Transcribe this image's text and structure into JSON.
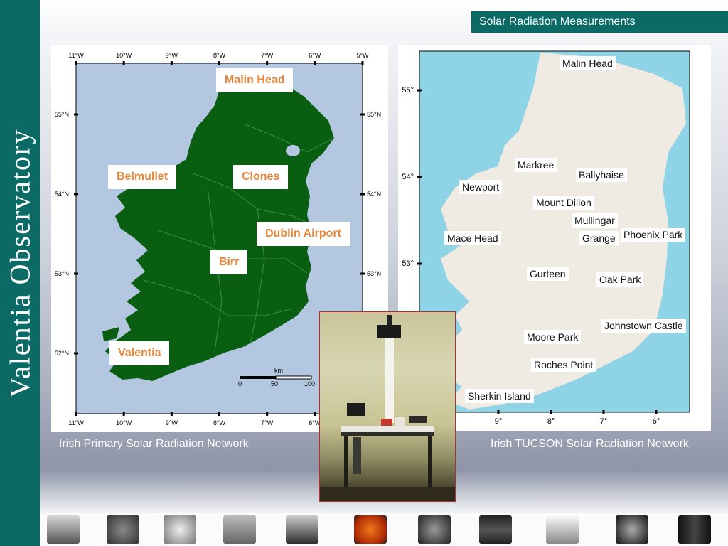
{
  "sidebar": {
    "title": "Valentia  Observatory"
  },
  "header": {
    "title": "Solar Radiation Measurements"
  },
  "left_map": {
    "caption": "Irish Primary Solar Radiation Network",
    "top_ticks": [
      "11°W",
      "10°W",
      "9°W",
      "8°W",
      "7°W",
      "6°W",
      "5°W"
    ],
    "bottom_ticks": [
      "11°W",
      "10°W",
      "9°W",
      "8°W",
      "7°W",
      "6°W"
    ],
    "left_ticks": [
      "55°N",
      "54°N",
      "53°N",
      "52°N"
    ],
    "right_ticks": [
      "55°N",
      "54°N",
      "53°N"
    ],
    "scale_unit": "km",
    "scale_values": [
      "0",
      "50",
      "100"
    ],
    "stations": [
      "Malin Head",
      "Belmullet",
      "Clones",
      "Dublin Airport",
      "Birr",
      "Valentia"
    ],
    "colors": {
      "sea": "#b3c7e0",
      "land": "#0a5e12"
    }
  },
  "right_map": {
    "caption": "Irish TUCSON Solar Radiation Network",
    "left_ticks": [
      "55°",
      "54°",
      "53°"
    ],
    "bottom_ticks": [
      "9°",
      "8°",
      "7°",
      "6°"
    ],
    "stations": [
      "Malin Head",
      "Markree",
      "Ballyhaise",
      "Newport",
      "Mount Dillon",
      "Mullingar",
      "Grange",
      "Phoenix Park",
      "Mace Head",
      "Gurteen",
      "Oak Park",
      "Johnstown Castle",
      "Moore Park",
      "Roches Point",
      "Sherkin Island"
    ],
    "colors": {
      "sea": "#8fd3e6",
      "land": "#efebe2"
    }
  },
  "photo": {
    "subject": "pyrheliometer-instrument-photo"
  },
  "thumbnails": [
    "building-thumb",
    "instrument-thumb",
    "sky-thumb",
    "sensor-thumb",
    "tree-thumb",
    "sun-thumb",
    "globe-thumb",
    "chart-thumb",
    "cloud-thumb",
    "coil-thumb",
    "seismic-thumb"
  ]
}
